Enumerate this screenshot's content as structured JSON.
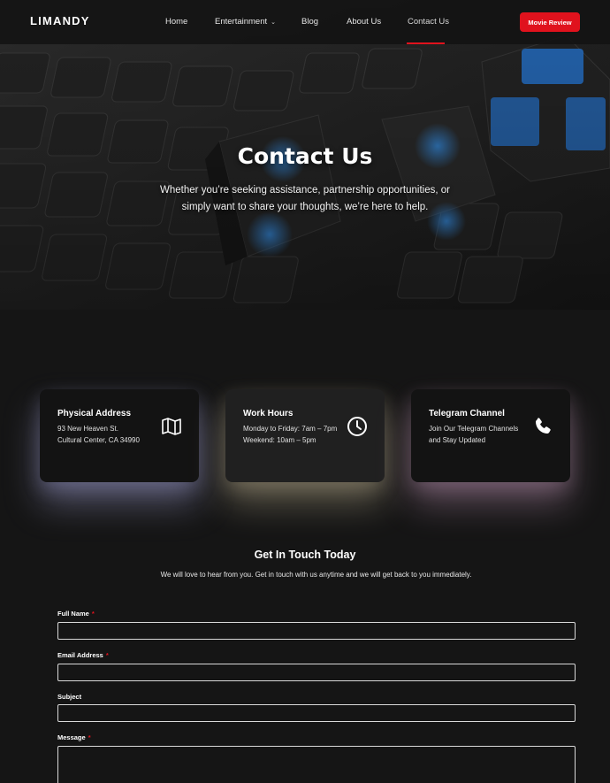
{
  "header": {
    "logo": "LIMANDY",
    "nav": [
      {
        "label": "Home"
      },
      {
        "label": "Entertainment",
        "has_dropdown": true
      },
      {
        "label": "Blog"
      },
      {
        "label": "About Us"
      },
      {
        "label": "Contact Us",
        "active": true
      }
    ],
    "cta_label": "Movie Review",
    "accent_color": "#e0121d"
  },
  "hero": {
    "title": "Contact Us",
    "subtitle": "Whether you’re seeking assistance, partnership opportunities, or simply want to share your thoughts, we’re here to help."
  },
  "cards": [
    {
      "title": "Physical Address",
      "line1": "93 New Heaven St.",
      "line2": "Cultural Center, CA 34990",
      "icon": "map-icon"
    },
    {
      "title": "Work Hours",
      "line1": "Monday to Friday: 7am – 7pm",
      "line2": "Weekend: 10am – 5pm",
      "icon": "clock-icon"
    },
    {
      "title": "Telegram Channel",
      "line1": "Join Our Telegram Channels",
      "line2": "and Stay Updated",
      "icon": "phone-icon"
    }
  ],
  "contact": {
    "title": "Get In Touch Today",
    "subtitle": "We will love to hear from you. Get in touch with us anytime and we will get back to you immediately.",
    "fields": [
      {
        "label": "Full Name",
        "required": true,
        "value": ""
      },
      {
        "label": "Email Address",
        "required": true,
        "value": ""
      },
      {
        "label": "Subject",
        "required": false,
        "value": ""
      },
      {
        "label": "Message",
        "required": true,
        "value": ""
      }
    ],
    "required_mark": "*"
  }
}
